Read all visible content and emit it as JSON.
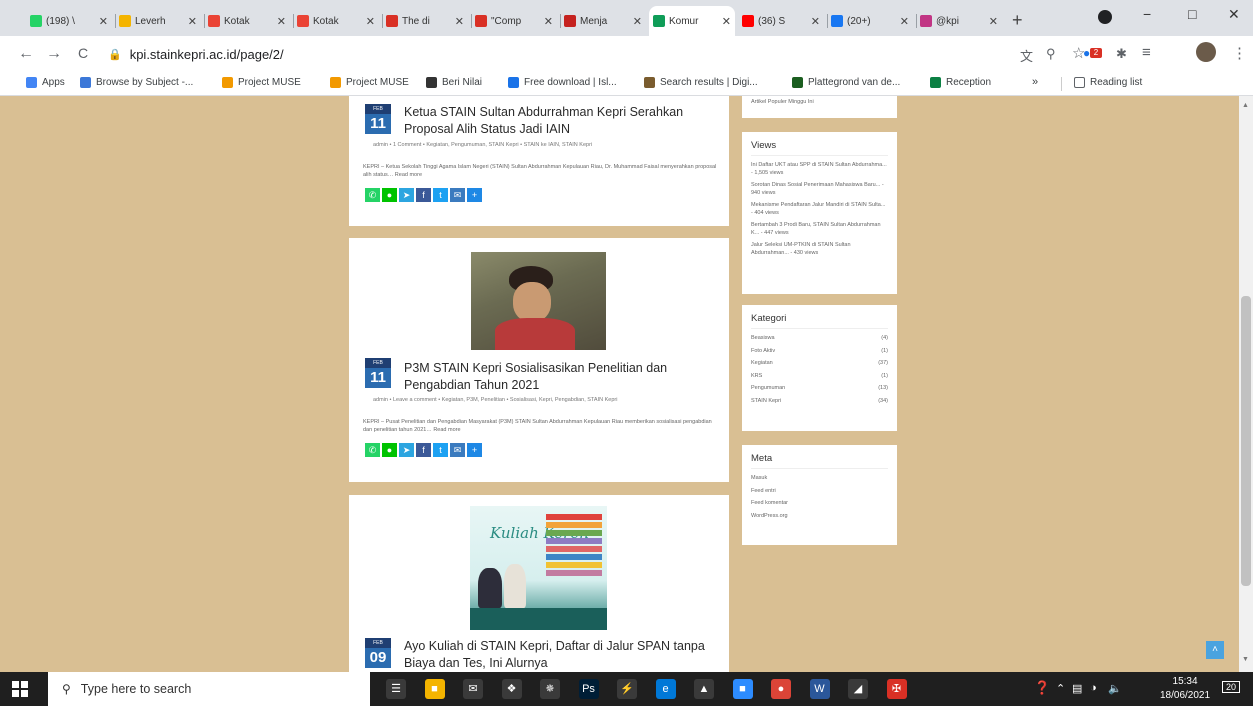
{
  "tabs": [
    {
      "label": "(198) \\",
      "color": "#25d366"
    },
    {
      "label": "Leverh",
      "color": "#f4b400"
    },
    {
      "label": "Kotak",
      "color": "#ea4335",
      "icon": "gmail-icon"
    },
    {
      "label": "Kotak",
      "color": "#ea4335",
      "icon": "gmail-icon"
    },
    {
      "label": "The di",
      "color": "#d93025"
    },
    {
      "label": "\"Comp",
      "color": "#d93025"
    },
    {
      "label": "Menja",
      "color": "#c5221f"
    },
    {
      "label": "Komur",
      "color": "#0f9d58"
    },
    {
      "label": "(36) S",
      "color": "#ff0000"
    },
    {
      "label": "(20+)",
      "color": "#1877f2"
    },
    {
      "label": "@kpi",
      "color": "#c13584"
    }
  ],
  "active_tab_index": 7,
  "new_tab_label": "+",
  "window_controls": {
    "minimize": "−",
    "maximize": "□",
    "close": "✕"
  },
  "toolbar": {
    "back": "←",
    "forward": "→",
    "reload": "C",
    "url": "kpi.stainkepri.ac.id/page/2/",
    "translate_icon": "translate-icon",
    "zoom_icon": "zoom-icon",
    "star": "☆",
    "ext_badge": "2",
    "puzzle": "✱",
    "queue": "≡",
    "menu": "⋮"
  },
  "bookmarks": [
    {
      "label": "Apps",
      "color": "#4285f4"
    },
    {
      "label": "Browse by Subject -...",
      "color": "#3c78d8"
    },
    {
      "label": "Project MUSE",
      "color": "#f29900"
    },
    {
      "label": "Project MUSE",
      "color": "#f29900"
    },
    {
      "label": "Beri Nilai",
      "color": "#333333"
    },
    {
      "label": "Free download | Isl...",
      "color": "#1a73e8"
    },
    {
      "label": "Search results | Digi...",
      "color": "#7a5c2e"
    },
    {
      "label": "Plattegrond van de...",
      "color": "#1b5e20"
    },
    {
      "label": "Reception",
      "color": "#0b8043"
    }
  ],
  "bookmarks_more": "»",
  "reading_list": "Reading list",
  "posts": [
    {
      "month": "FEB",
      "day": "11",
      "title": "Ketua STAIN Sultan Abdurrahman Kepri Serahkan Proposal Alih Status Jadi IAIN",
      "meta": "admin  •  1 Comment  •  Kegiatan, Pengumuman, STAIN Kepri  •  STAIN ke IAIN, STAIN Kepri",
      "excerpt": "KEPRI – Ketua Sekolah Tinggi Agama Islam Negeri (STAIN) Sultan Abdurrahman Kepulauan Riau, Dr. Muhammad Faisal menyerahkan proposal alih status… Read more"
    },
    {
      "month": "FEB",
      "day": "11",
      "title": "P3M STAIN Kepri Sosialisasikan Penelitian dan Pengabdian Tahun 2021",
      "meta": "admin  •  Leave a comment  •  Kegiatan, P3M, Penelitian  •  Sosialisasi, Kepri, Pengabdian, STAIN Kepri",
      "excerpt": "KEPRI – Pusat Penelitian dan Pengabdian Masyarakat (P3M) STAIN Sultan Abdurrahman Kepulauan Riau memberikan sosialisasi pengabdian dan penelitian tahun 2021… Read more"
    },
    {
      "month": "FEB",
      "day": "09",
      "title": "Ayo Kuliah di STAIN Kepri, Daftar di Jalur SPAN tanpa Biaya dan Tes, Ini Alurnya",
      "poster_text": "Kuliah Keren"
    }
  ],
  "share_buttons": [
    {
      "name": "whatsapp",
      "color": "#25d366",
      "glyph": "✆"
    },
    {
      "name": "line",
      "color": "#00c300",
      "glyph": "●"
    },
    {
      "name": "telegram",
      "color": "#2ca5e0",
      "glyph": "➤"
    },
    {
      "name": "facebook",
      "color": "#3b5998",
      "glyph": "f"
    },
    {
      "name": "twitter",
      "color": "#1da1f2",
      "glyph": "t"
    },
    {
      "name": "email",
      "color": "#3b7bbf",
      "glyph": "✉"
    },
    {
      "name": "more",
      "color": "#1e88e5",
      "glyph": "+"
    }
  ],
  "sidebar": {
    "top_partial": "Artikel Populer Minggu Ini",
    "views": {
      "title": "Views",
      "items": [
        "Ini Daftar UKT atau SPP di STAIN Sultan Abdurrahma... - 1,505 views",
        "Sorotan Dinas Sosial Penerimaan Mahasiswa Baru... - 940 views",
        "Mekanisme Pendaftaran Jalur Mandiri di STAIN Sulta... - 404 views",
        "Bertambah 3 Prodi Baru, STAIN Sultan Abdurrahman K... - 447 views",
        "Jalur Seleksi UM-PTKIN di STAIN Sultan Abdurrahman... - 430 views"
      ]
    },
    "kategori": {
      "title": "Kategori",
      "items": [
        {
          "label": "Beasiswa",
          "count": "(4)"
        },
        {
          "label": "Foto Aktiv",
          "count": "(1)"
        },
        {
          "label": "Kegiatan",
          "count": "(37)"
        },
        {
          "label": "KRS",
          "count": "(1)"
        },
        {
          "label": "Pengumuman",
          "count": "(13)"
        },
        {
          "label": "STAIN Kepri",
          "count": "(34)"
        }
      ]
    },
    "meta": {
      "title": "Meta",
      "items": [
        "Masuk",
        "Feed entri",
        "Feed komentar",
        "WordPress.org"
      ]
    }
  },
  "back_to_top": "˄",
  "taskbar": {
    "search_placeholder": "Type here to search",
    "apps": [
      {
        "name": "task-view",
        "color": "#3a3a3a",
        "glyph": "☰"
      },
      {
        "name": "file-explorer",
        "color": "#f4b400",
        "glyph": "■"
      },
      {
        "name": "mail",
        "color": "#3a3a3a",
        "glyph": "✉"
      },
      {
        "name": "dropbox",
        "color": "#3a3a3a",
        "glyph": "❖"
      },
      {
        "name": "chrome-alt",
        "color": "#3a3a3a",
        "glyph": "✵"
      },
      {
        "name": "photoshop",
        "color": "#001e36",
        "glyph": "Ps"
      },
      {
        "name": "bolt",
        "color": "#3a3a3a",
        "glyph": "⚡"
      },
      {
        "name": "edge",
        "color": "#0078d7",
        "glyph": "e"
      },
      {
        "name": "photos",
        "color": "#3a3a3a",
        "glyph": "▲"
      },
      {
        "name": "zoom",
        "color": "#2d8cff",
        "glyph": "■"
      },
      {
        "name": "chrome",
        "color": "#db4437",
        "glyph": "●"
      },
      {
        "name": "word",
        "color": "#2b579a",
        "glyph": "W"
      },
      {
        "name": "settings",
        "color": "#3a3a3a",
        "glyph": "◢"
      },
      {
        "name": "acrobat",
        "color": "#d93025",
        "glyph": "✠"
      }
    ],
    "time": "15:34",
    "date": "18/06/2021",
    "notification_count": "20"
  }
}
